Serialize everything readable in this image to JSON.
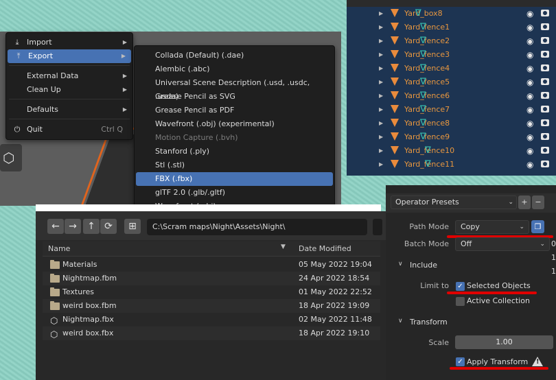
{
  "file_menu": {
    "items": [
      {
        "label": "Import",
        "icon": "import-icon",
        "submenu": true
      },
      {
        "label": "Export",
        "icon": "export-icon",
        "submenu": true,
        "active": true
      },
      {
        "label": "External Data",
        "submenu": true
      },
      {
        "label": "Clean Up",
        "submenu": true
      },
      {
        "label": "Defaults",
        "submenu": true
      },
      {
        "label": "Quit",
        "icon": "power-icon",
        "shortcut": "Ctrl Q"
      }
    ]
  },
  "export_menu": {
    "items": [
      {
        "label": "Collada (Default) (.dae)"
      },
      {
        "label": "Alembic (.abc)"
      },
      {
        "label": "Universal Scene Description (.usd, .usdc, .usda)"
      },
      {
        "label": "Grease Pencil as SVG"
      },
      {
        "label": "Grease Pencil as PDF"
      },
      {
        "label": "Wavefront (.obj) (experimental)"
      },
      {
        "label": "Motion Capture (.bvh)",
        "disabled": true
      },
      {
        "label": "Stanford (.ply)"
      },
      {
        "label": "Stl (.stl)"
      },
      {
        "label": "FBX (.fbx)",
        "selected": true
      },
      {
        "label": "glTF 2.0 (.glb/.gltf)"
      },
      {
        "label": "Wavefront (.obj)"
      }
    ]
  },
  "outliner": {
    "rows": [
      "Yard_box8",
      "Yard_fence1",
      "Yard_fence2",
      "Yard_fence3",
      "Yard_fence4",
      "Yard_fence5",
      "Yard_fence6",
      "Yard_fence7",
      "Yard_fence8",
      "Yard_fence9",
      "Yard_fence10",
      "Yard_fence11"
    ],
    "name_color": "#e8973f",
    "mesh_color": "#38c6b5"
  },
  "file_browser": {
    "path": "C:\\Scram maps\\Night\\Assets\\Night\\",
    "columns": {
      "name": "Name",
      "date": "Date Modified"
    },
    "files": [
      {
        "name": "Materials",
        "date": "05 May 2022 19:04",
        "type": "folder"
      },
      {
        "name": "Nightmap.fbm",
        "date": "24 Apr 2022 18:54",
        "type": "folder"
      },
      {
        "name": "Textures",
        "date": "01 May 2022 22:52",
        "type": "folder"
      },
      {
        "name": "weird box.fbm",
        "date": "18 Apr 2022 19:09",
        "type": "folder"
      },
      {
        "name": "Nightmap.fbx",
        "date": "02 May 2022 11:48",
        "type": "file"
      },
      {
        "name": "weird box.fbx",
        "date": "18 Apr 2022 19:10",
        "type": "file"
      }
    ]
  },
  "properties": {
    "operator_presets": "Operator Presets",
    "path_mode_label": "Path Mode",
    "path_mode_value": "Copy",
    "batch_mode_label": "Batch Mode",
    "batch_mode_value": "Off",
    "include_section": "Include",
    "limit_to_label": "Limit to",
    "selected_objects": "Selected Objects",
    "selected_objects_checked": true,
    "active_collection": "Active Collection",
    "active_collection_checked": false,
    "transform_section": "Transform",
    "scale_label": "Scale",
    "scale_value": "1.00",
    "apply_transform": "Apply Transform",
    "apply_transform_checked": true,
    "edge_digits": [
      "0",
      "1",
      "1"
    ]
  },
  "colors": {
    "accent": "#4772b3",
    "annotation_red": "#e00000",
    "background_teal": "#8ecfc2"
  }
}
